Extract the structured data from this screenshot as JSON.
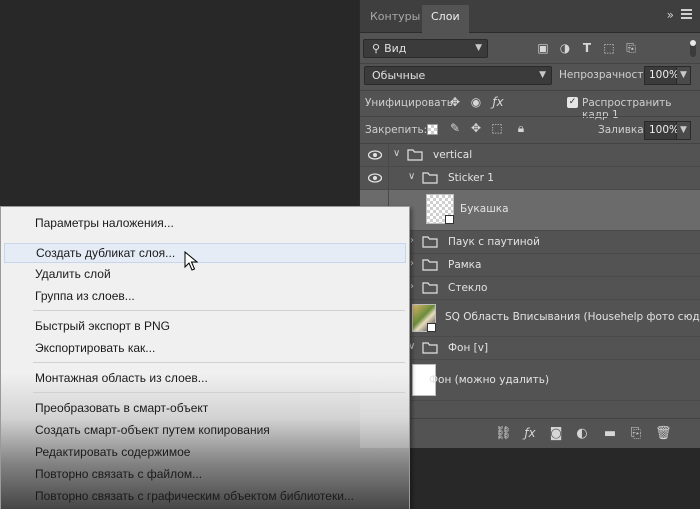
{
  "panel": {
    "tabs": [
      "Контуры",
      "Слои"
    ],
    "collapse_glyph": "»",
    "filter": {
      "label": "Вид"
    },
    "blend_mode": "Обычные",
    "opacity_label": "Непрозрачность:",
    "opacity_value": "100%",
    "unify_label": "Унифицировать:",
    "propagate_label": "Распространить кадр 1",
    "propagate_checked": true,
    "lock_label": "Закрепить:",
    "fill_label": "Заливка:",
    "fill_value": "100%",
    "layers": [
      {
        "name": "vertical",
        "type": "group",
        "visible": true,
        "expanded": true
      },
      {
        "name": "Sticker 1",
        "type": "group",
        "visible": true,
        "expanded": true
      },
      {
        "name": "Букашка",
        "type": "smart-object",
        "visible": true,
        "selected": true
      },
      {
        "name": "Паук с паутиной",
        "type": "group",
        "expanded": false
      },
      {
        "name": "Рамка",
        "type": "group",
        "expanded": false
      },
      {
        "name": "Стекло",
        "type": "group",
        "expanded": false
      },
      {
        "name": "SQ Область Вписывания (Househelp фото сюда) ...",
        "type": "smart-object"
      },
      {
        "name": "Фон [v]",
        "type": "group",
        "expanded": true
      },
      {
        "name": "Фон (можно удалить)",
        "type": "layer"
      }
    ]
  },
  "context_menu": {
    "items": [
      "Параметры наложения...",
      "Создать дубликат слоя...",
      "Удалить слой",
      "Группа из слоев...",
      "Быстрый экспорт в PNG",
      "Экспортировать как...",
      "Монтажная область из слоев...",
      "Преобразовать в смарт-объект",
      "Создать смарт-объект путем копирования",
      "Редактировать содержимое",
      "Повторно связать с файлом...",
      "Повторно связать с графическим объектом библиотеки..."
    ],
    "hovered_index": 1
  },
  "colors": {
    "panel_bg": "#535353",
    "tabbar_bg": "#3f3f3f",
    "selected_layer": "#6b6b6b",
    "menu_bg": "#f0f0f0",
    "menu_hover": "#e5ecf6"
  },
  "icons": [
    "search-icon",
    "image-filter-icon",
    "adjustment-filter-icon",
    "type-filter-icon",
    "shape-filter-icon",
    "smart-object-filter-icon",
    "eye-icon",
    "folder-icon",
    "link-icon",
    "fx-icon",
    "mask-icon",
    "adjustment-layer-icon",
    "new-group-icon",
    "new-layer-icon",
    "trash-icon",
    "mouse-cursor-icon"
  ]
}
